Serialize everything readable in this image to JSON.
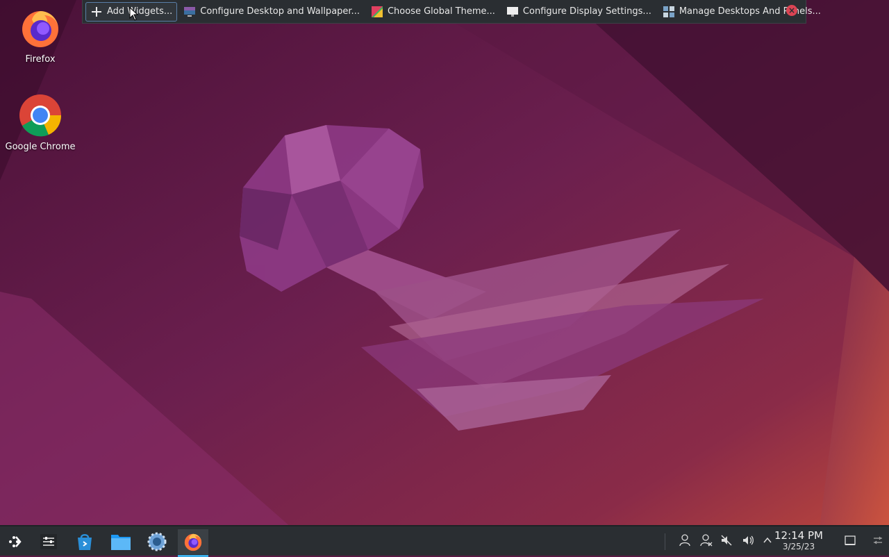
{
  "desktop": {
    "icons": [
      {
        "label": "Firefox",
        "icon": "firefox-icon"
      },
      {
        "label": "Google Chrome",
        "icon": "chrome-icon"
      }
    ]
  },
  "toolbox": {
    "items": [
      {
        "label": "Add Widgets...",
        "icon": "plus-icon"
      },
      {
        "label": "Configure Desktop and Wallpaper...",
        "icon": "wallpaper-icon"
      },
      {
        "label": "Choose Global Theme...",
        "icon": "theme-icon"
      },
      {
        "label": "Configure Display Settings...",
        "icon": "display-icon"
      },
      {
        "label": "Manage Desktops And Panels...",
        "icon": "panels-icon"
      }
    ],
    "close_icon": "close-icon"
  },
  "taskbar": {
    "launchers": [
      {
        "icon": "app-launcher-icon"
      },
      {
        "icon": "system-settings-icon"
      },
      {
        "icon": "discover-store-icon"
      },
      {
        "icon": "file-manager-icon"
      },
      {
        "icon": "settings-gear-icon"
      },
      {
        "icon": "firefox-icon"
      }
    ],
    "tray": {
      "icons": [
        "user-icon",
        "network-icon",
        "microphone-muted-icon",
        "volume-icon",
        "expand-arrow-icon"
      ],
      "time": "12:14 PM",
      "date": "3/25/23",
      "show_desktop_icon": "show-desktop-icon",
      "panel_config_icon": "panel-config-icon"
    }
  },
  "colors": {
    "panel_bg": "#2a2e32",
    "accent": "#3daee9",
    "close_red": "#da4453"
  }
}
